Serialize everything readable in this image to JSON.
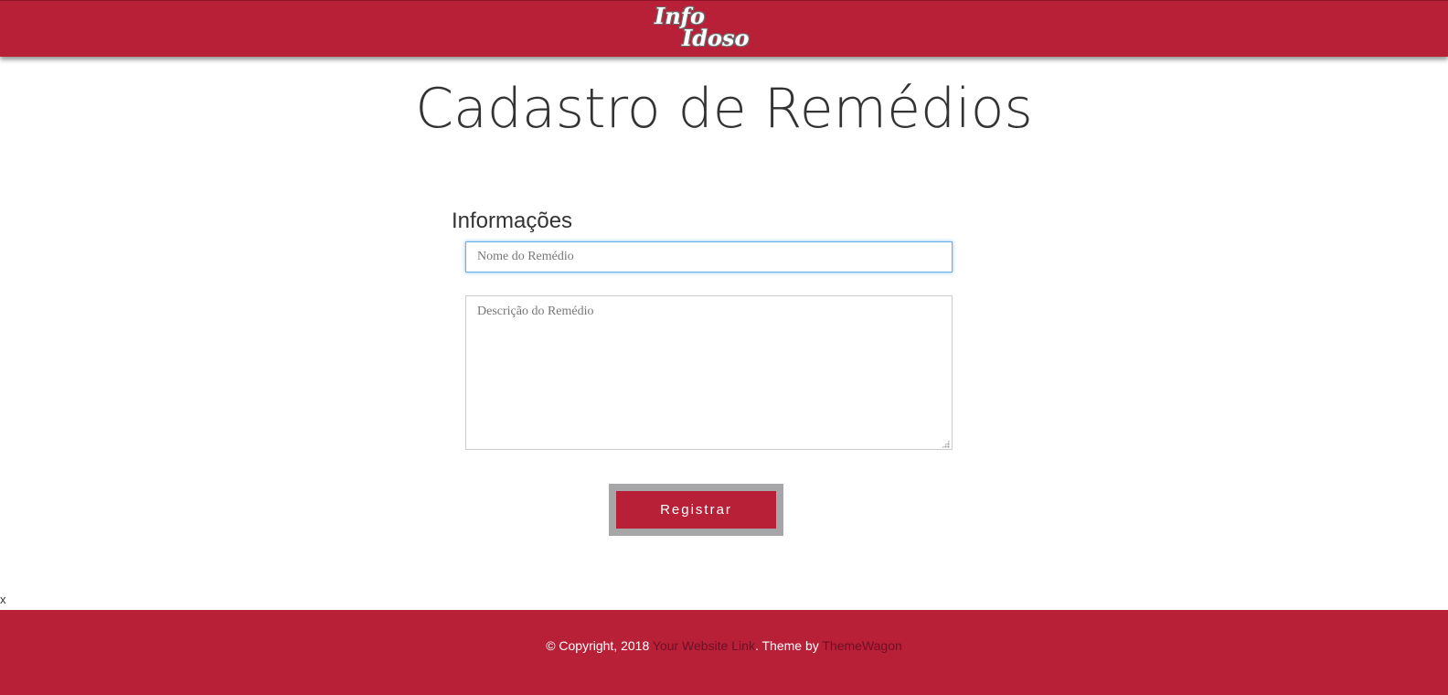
{
  "header": {
    "logo_line1": "Info",
    "logo_line2": "Idoso",
    "background_color": "#b82038"
  },
  "main": {
    "title": "Cadastro de Remédios",
    "section_heading": "Informações",
    "name_input": {
      "placeholder": "Nome do Remédio",
      "value": ""
    },
    "description_textarea": {
      "placeholder": "Descrição do Remédio",
      "value": ""
    },
    "submit_label": "Registrar"
  },
  "stray_text": "x",
  "footer": {
    "copyright": "© Copyright, 2018",
    "website_link": "Your Website Link",
    "theme_by": "Theme by",
    "theme_link": "ThemeWagon"
  }
}
